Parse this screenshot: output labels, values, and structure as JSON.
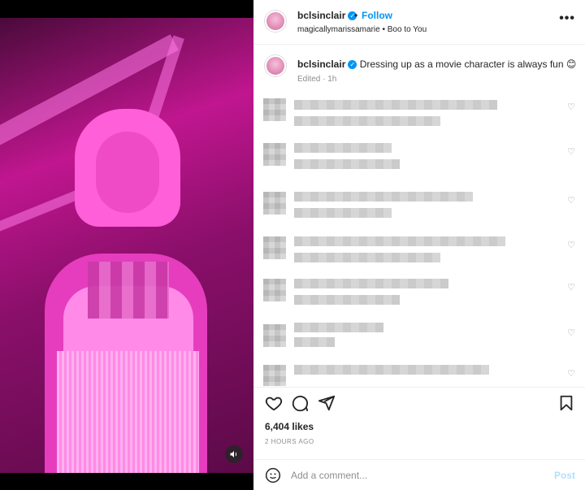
{
  "post": {
    "username": "bclsinclair",
    "separator": "•",
    "follow_label": "Follow",
    "subtitle": "magicallymarissamarie • Boo to You",
    "more_label": "•••"
  },
  "caption": {
    "username": "bclsinclair",
    "text": "Dressing up as a movie character is always fun 😊",
    "edited": "Edited · 1h"
  },
  "stats": {
    "likes": "6,404 likes",
    "time": "2 HOURS AGO"
  },
  "comment_input": {
    "placeholder": "Add a comment...",
    "post_label": "Post"
  },
  "icons": {
    "verified": "verified-badge-icon",
    "heart": "heart-icon",
    "comment": "comment-icon",
    "share": "share-icon",
    "save": "bookmark-icon",
    "emoji": "emoji-icon",
    "mute": "speaker-icon"
  },
  "colors": {
    "accent": "#0095f6",
    "post_disabled": "#b2dffc"
  }
}
